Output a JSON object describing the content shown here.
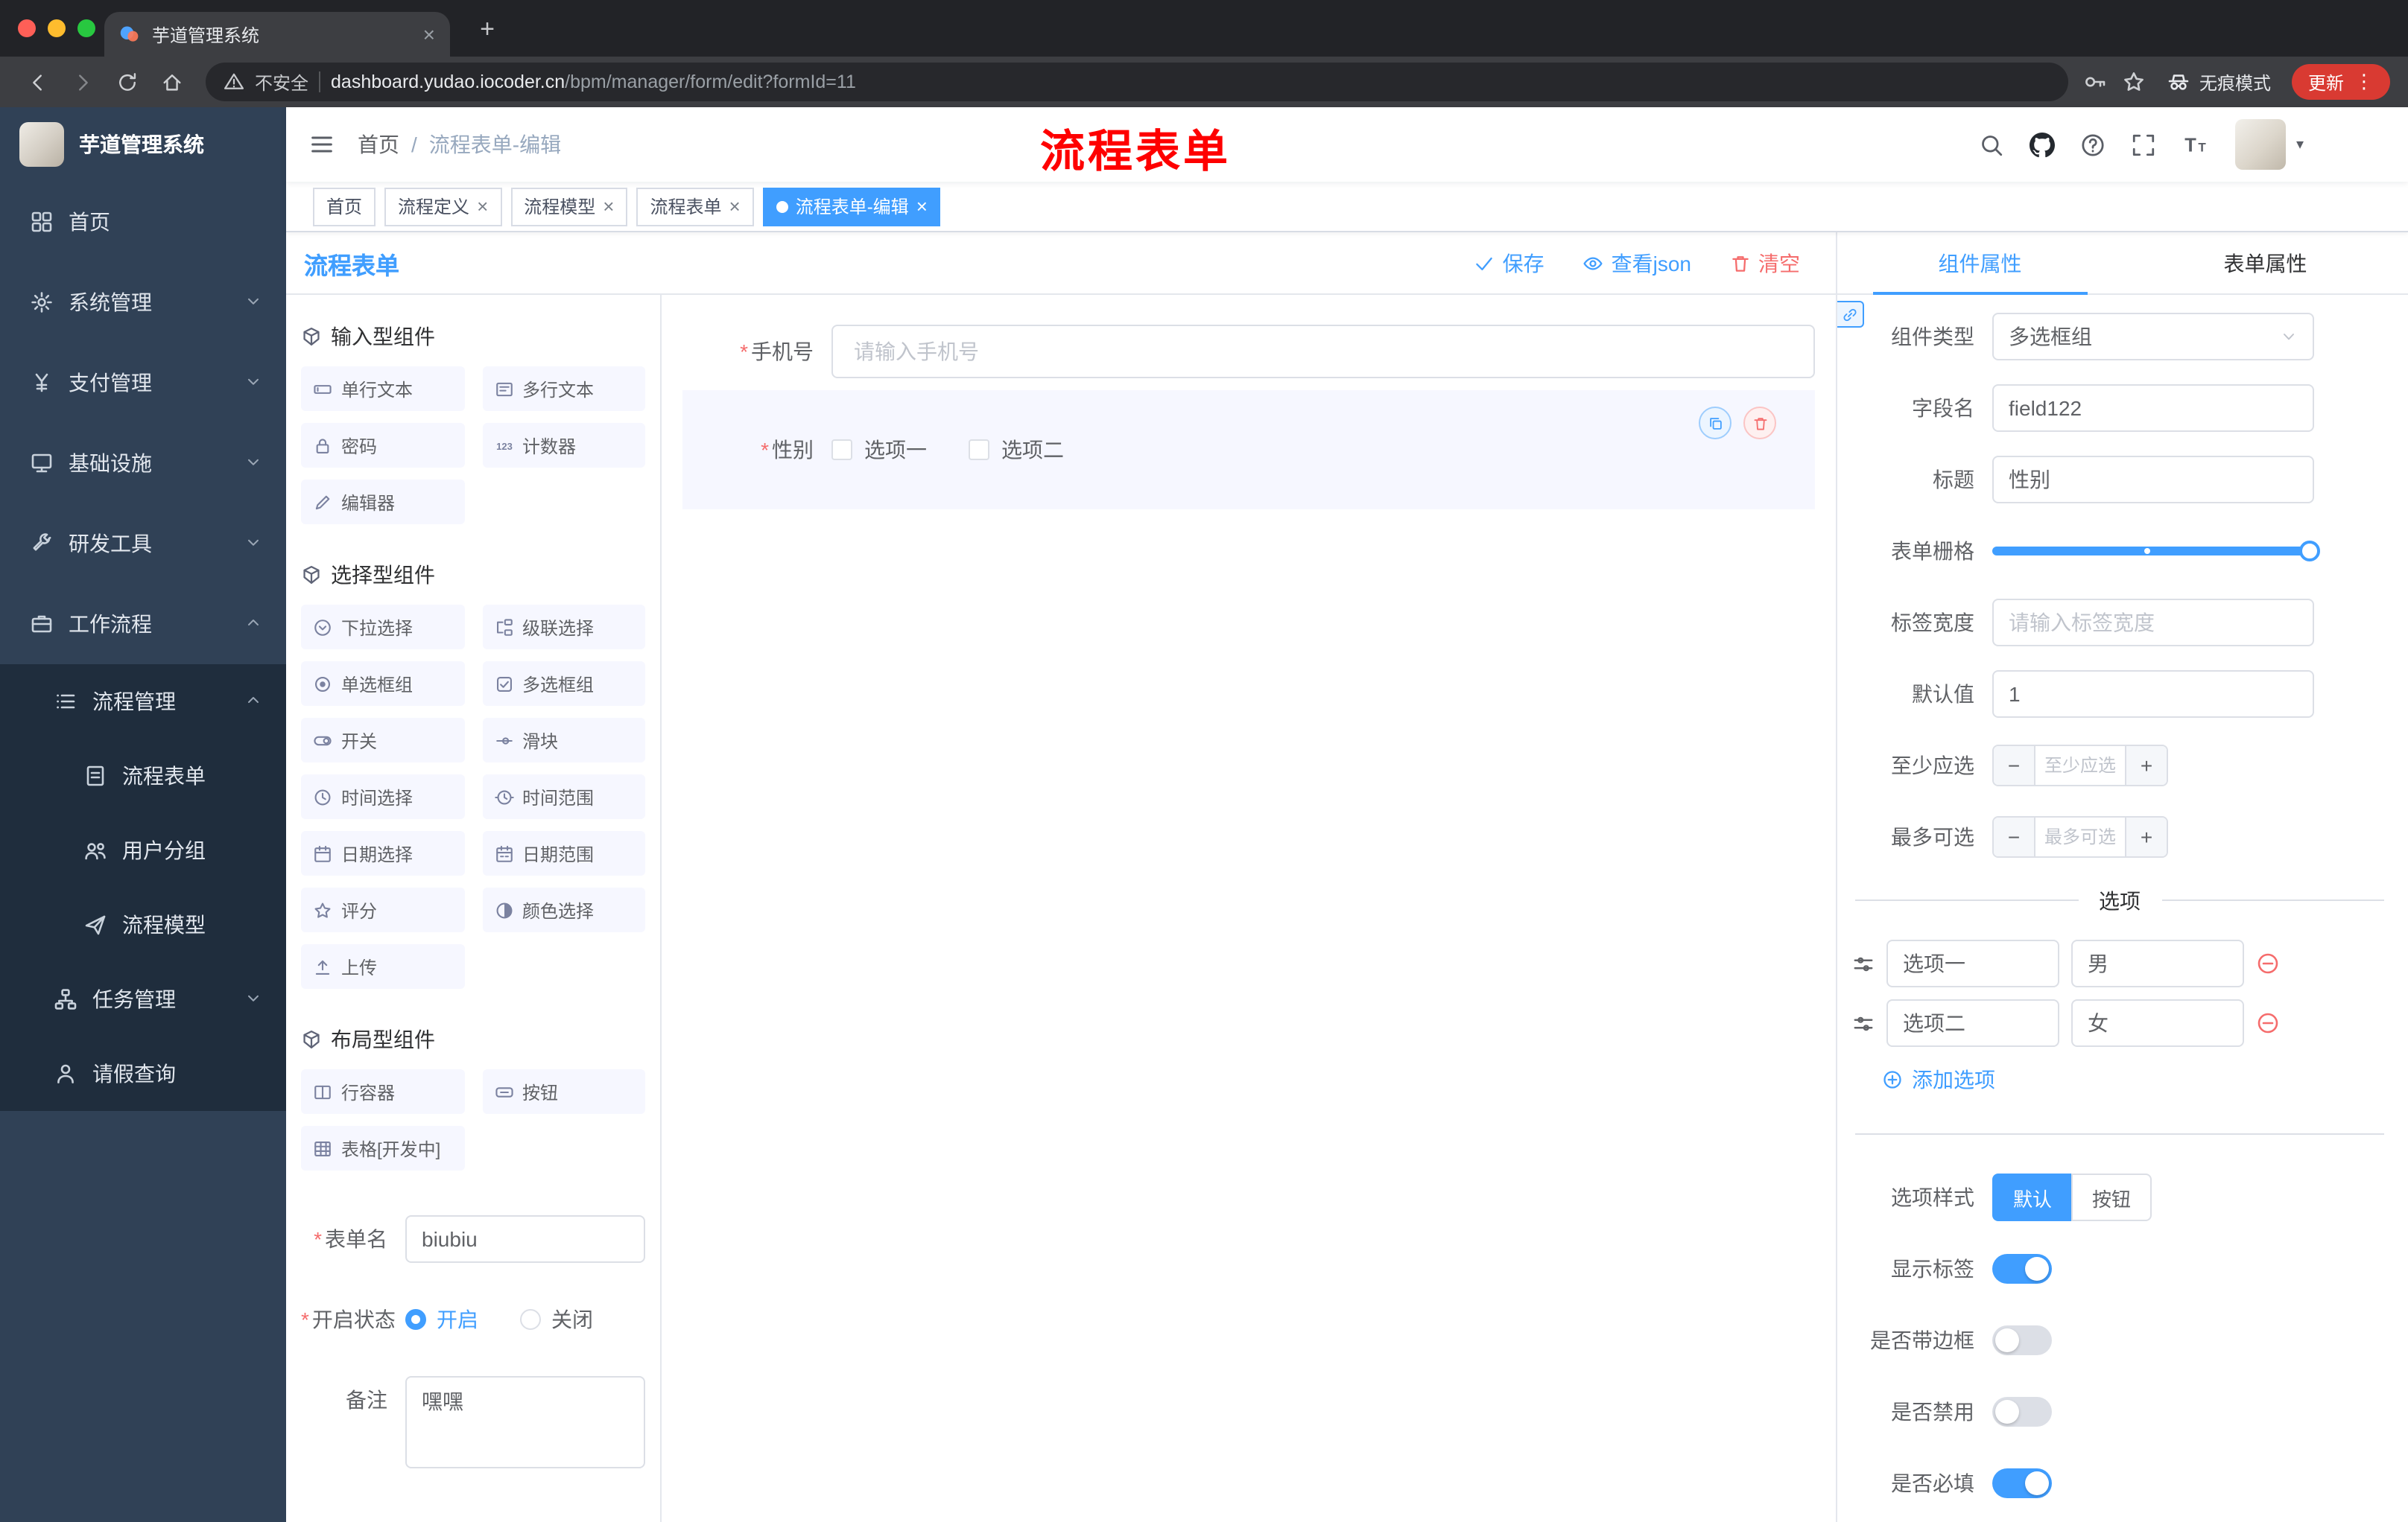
{
  "ui": {
    "required_mark": "*",
    "stepper_minus": "−",
    "stepper_plus": "+",
    "more_dots": "⋮",
    "close_mark": "×",
    "new_tab_mark": "+"
  },
  "colors": {
    "accent": "#409EFF",
    "danger": "#F56C6C",
    "sidebar_bg": "#304156",
    "submenu_bg": "#1F2D3D",
    "annotation_red": "#FE0000",
    "active_tag": "#409EFF"
  },
  "browser": {
    "tab_title": "芋道管理系统",
    "security_label": "不安全",
    "url_host": "dashboard.yudao.iocoder.cn",
    "url_path": "/bpm/manager/form/edit?formId=11",
    "incognito_label": "无痕模式",
    "update_label": "更新"
  },
  "sidebar": {
    "logo_title": "芋道管理系统",
    "items": [
      {
        "label": "首页",
        "icon": "dashboard-icon",
        "level": 0
      },
      {
        "label": "系统管理",
        "icon": "gear-icon",
        "level": 0,
        "chevron": "down"
      },
      {
        "label": "支付管理",
        "icon": "yen-icon",
        "level": 0,
        "chevron": "down"
      },
      {
        "label": "基础设施",
        "icon": "infra-icon",
        "level": 0,
        "chevron": "down"
      },
      {
        "label": "研发工具",
        "icon": "tools-icon",
        "level": 0,
        "chevron": "down"
      },
      {
        "label": "工作流程",
        "icon": "workflow-icon",
        "level": 0,
        "chevron": "up"
      },
      {
        "label": "流程管理",
        "icon": "list-icon",
        "level": 1,
        "chevron": "up"
      },
      {
        "label": "流程表单",
        "icon": "form-icon",
        "level": 2
      },
      {
        "label": "用户分组",
        "icon": "users-icon",
        "level": 2
      },
      {
        "label": "流程模型",
        "icon": "send-icon",
        "level": 2
      },
      {
        "label": "任务管理",
        "icon": "tree-icon",
        "level": 1,
        "chevron": "down"
      },
      {
        "label": "请假查询",
        "icon": "user-icon",
        "level": 1
      }
    ]
  },
  "header": {
    "breadcrumb": [
      "首页",
      "流程表单-编辑"
    ],
    "separator": "/",
    "annotation": "流程表单"
  },
  "tags": [
    {
      "label": "首页",
      "closable": false,
      "active": false
    },
    {
      "label": "流程定义",
      "closable": true,
      "active": false
    },
    {
      "label": "流程模型",
      "closable": true,
      "active": false
    },
    {
      "label": "流程表单",
      "closable": true,
      "active": false
    },
    {
      "label": "流程表单-编辑",
      "closable": true,
      "active": true
    }
  ],
  "editor": {
    "title": "流程表单",
    "actions": {
      "save": "保存",
      "view_json": "查看json",
      "clear": "清空"
    }
  },
  "palette": {
    "groups": [
      {
        "title": "输入型组件",
        "items": [
          {
            "label": "单行文本",
            "icon": "input-icon"
          },
          {
            "label": "多行文本",
            "icon": "textarea-icon"
          },
          {
            "label": "密码",
            "icon": "lock-icon"
          },
          {
            "label": "计数器",
            "icon": "counter-icon"
          },
          {
            "label": "编辑器",
            "icon": "editor-icon"
          }
        ]
      },
      {
        "title": "选择型组件",
        "items": [
          {
            "label": "下拉选择",
            "icon": "select-icon"
          },
          {
            "label": "级联选择",
            "icon": "cascade-icon"
          },
          {
            "label": "单选框组",
            "icon": "radio-icon"
          },
          {
            "label": "多选框组",
            "icon": "checkbox-comp-icon"
          },
          {
            "label": "开关",
            "icon": "switch-icon"
          },
          {
            "label": "滑块",
            "icon": "slider-icon"
          },
          {
            "label": "时间选择",
            "icon": "time-icon"
          },
          {
            "label": "时间范围",
            "icon": "time-range-icon"
          },
          {
            "label": "日期选择",
            "icon": "date-icon"
          },
          {
            "label": "日期范围",
            "icon": "date-range-icon"
          },
          {
            "label": "评分",
            "icon": "rate-icon"
          },
          {
            "label": "颜色选择",
            "icon": "color-icon"
          },
          {
            "label": "上传",
            "icon": "upload-icon"
          }
        ]
      },
      {
        "title": "布局型组件",
        "items": [
          {
            "label": "行容器",
            "icon": "row-icon"
          },
          {
            "label": "按钮",
            "icon": "button-icon"
          },
          {
            "label": "表格[开发中]",
            "icon": "table-icon"
          }
        ]
      }
    ],
    "form": {
      "name_label": "表单名",
      "name_value": "biubiu",
      "status_label": "开启状态",
      "status_options": [
        "开启",
        "关闭"
      ],
      "status_checked": "开启",
      "remark_label": "备注",
      "remark_value": "嘿嘿"
    }
  },
  "canvas": {
    "phone_field": {
      "label": "手机号",
      "placeholder": "请输入手机号",
      "required": true
    },
    "gender_field": {
      "label": "性别",
      "required": true,
      "options": [
        "选项一",
        "选项二"
      ],
      "selected": true
    }
  },
  "properties": {
    "tabs": [
      {
        "label": "组件属性",
        "active": true
      },
      {
        "label": "表单属性",
        "active": false
      }
    ],
    "component_type": {
      "label": "组件类型",
      "value": "多选框组"
    },
    "field_name": {
      "label": "字段名",
      "value": "field122"
    },
    "title": {
      "label": "标题",
      "value": "性别"
    },
    "grid": {
      "label": "表单栅格"
    },
    "label_width": {
      "label": "标签宽度",
      "placeholder": "请输入标签宽度"
    },
    "default_value": {
      "label": "默认值",
      "value": "1"
    },
    "min_select": {
      "label": "至少应选",
      "placeholder": "至少应选"
    },
    "max_select": {
      "label": "最多可选",
      "placeholder": "最多可选"
    },
    "options_title": "选项",
    "options": [
      {
        "label": "选项一",
        "value": "男"
      },
      {
        "label": "选项二",
        "value": "女"
      }
    ],
    "add_option": "添加选项",
    "option_style": {
      "label": "选项样式",
      "options": [
        "默认",
        "按钮"
      ],
      "selected": "默认"
    },
    "switches": [
      {
        "label": "显示标签",
        "on": true
      },
      {
        "label": "是否带边框",
        "on": false
      },
      {
        "label": "是否禁用",
        "on": false
      },
      {
        "label": "是否必填",
        "on": true
      }
    ]
  }
}
